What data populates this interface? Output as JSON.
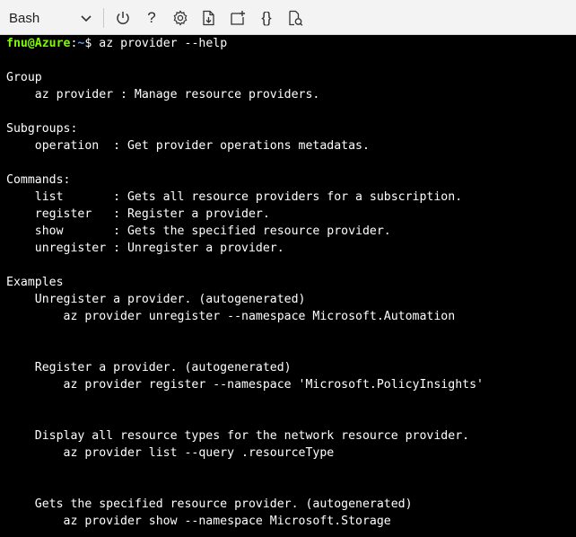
{
  "toolbar": {
    "shell_value": "Bash",
    "icons": [
      "power-icon",
      "help-icon",
      "settings-icon",
      "upload-download-icon",
      "new-session-icon",
      "editor-braces-icon",
      "web-preview-icon"
    ],
    "help_glyph": "?",
    "braces_glyph": "{}"
  },
  "terminal": {
    "prompt_user": "fnu@Azure",
    "prompt_sep": ":",
    "prompt_path": "~",
    "prompt_symbol": "$ ",
    "command": "az provider --help",
    "lines": [
      "",
      "Group",
      "    az provider : Manage resource providers.",
      "",
      "Subgroups:",
      "    operation  : Get provider operations metadatas.",
      "",
      "Commands:",
      "    list       : Gets all resource providers for a subscription.",
      "    register   : Register a provider.",
      "    show       : Gets the specified resource provider.",
      "    unregister : Unregister a provider.",
      "",
      "Examples",
      "    Unregister a provider. (autogenerated)",
      "        az provider unregister --namespace Microsoft.Automation",
      "",
      "",
      "    Register a provider. (autogenerated)",
      "        az provider register --namespace 'Microsoft.PolicyInsights'",
      "",
      "",
      "    Display all resource types for the network resource provider.",
      "        az provider list --query .resourceType",
      "",
      "",
      "    Gets the specified resource provider. (autogenerated)",
      "        az provider show --namespace Microsoft.Storage"
    ]
  }
}
